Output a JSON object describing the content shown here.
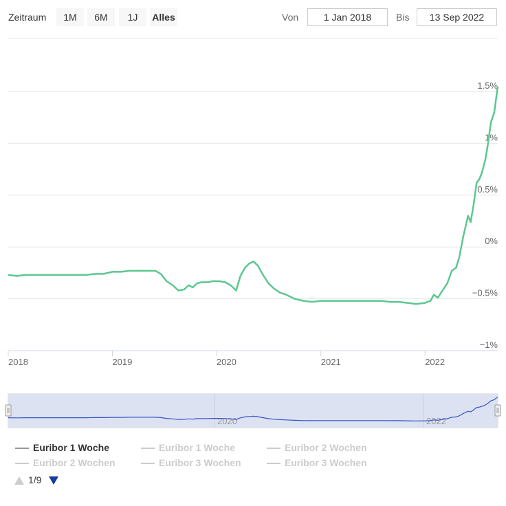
{
  "toolbar": {
    "zoom_label": "Zeitraum",
    "buttons": [
      "1M",
      "6M",
      "1J",
      "Alles"
    ],
    "active_button": "Alles",
    "from_label": "Von",
    "from_value": "1 Jan 2018",
    "to_label": "Bis",
    "to_value": "13 Sep 2022"
  },
  "legend": {
    "items": [
      "Euribor 1 Woche",
      "Euribor 1 Woche",
      "Euribor 2 Wochen",
      "Euribor 2 Wochen",
      "Euribor 3 Wochen",
      "Euribor 3 Wochen"
    ],
    "active_index": 0,
    "pager_text": "1/9"
  },
  "colors": {
    "series_line": "#5cc78f",
    "navigator_line": "#3356c2",
    "navigator_fill": "#dde2f2",
    "grid": "#e6e6e6",
    "inactive": "#cccccc",
    "arrow_active": "#1a3a9c"
  },
  "chart_data": {
    "type": "line",
    "title": "",
    "xlabel": "",
    "ylabel": "",
    "ylim": [
      -1,
      1.5
    ],
    "x_tick_labels": [
      "2018",
      "2019",
      "2020",
      "2021",
      "2022"
    ],
    "y_tick_labels": [
      "1.5%",
      "1%",
      "0.5%",
      "0%",
      "−0.5%",
      "−1%"
    ],
    "y_ticks": [
      1.5,
      1,
      0.5,
      0,
      -0.5,
      -1
    ],
    "navigator_labels": [
      "2020",
      "2022"
    ],
    "grid": true,
    "series": [
      {
        "name": "Euribor 1 Woche",
        "x": [
          "2018-01-01",
          "2018-02-01",
          "2018-03-01",
          "2018-04-01",
          "2018-05-01",
          "2018-06-01",
          "2018-07-01",
          "2018-08-01",
          "2018-09-01",
          "2018-10-01",
          "2018-11-01",
          "2018-12-01",
          "2019-01-01",
          "2019-02-01",
          "2019-03-01",
          "2019-04-01",
          "2019-05-01",
          "2019-06-01",
          "2019-06-20",
          "2019-07-10",
          "2019-08-01",
          "2019-08-20",
          "2019-09-10",
          "2019-09-25",
          "2019-10-10",
          "2019-10-25",
          "2019-11-10",
          "2019-12-01",
          "2019-12-20",
          "2020-01-10",
          "2020-02-01",
          "2020-02-20",
          "2020-03-10",
          "2020-03-25",
          "2020-04-10",
          "2020-04-25",
          "2020-05-10",
          "2020-05-25",
          "2020-06-10",
          "2020-07-01",
          "2020-07-20",
          "2020-08-10",
          "2020-09-01",
          "2020-10-01",
          "2020-11-01",
          "2020-12-01",
          "2021-01-01",
          "2021-02-01",
          "2021-03-01",
          "2021-04-01",
          "2021-05-01",
          "2021-06-01",
          "2021-07-01",
          "2021-08-01",
          "2021-09-01",
          "2021-10-01",
          "2021-11-01",
          "2021-12-01",
          "2022-01-01",
          "2022-01-20",
          "2022-02-01",
          "2022-02-15",
          "2022-03-01",
          "2022-03-20",
          "2022-04-05",
          "2022-04-20",
          "2022-05-01",
          "2022-05-15",
          "2022-06-01",
          "2022-06-10",
          "2022-06-20",
          "2022-07-01",
          "2022-07-10",
          "2022-07-20",
          "2022-08-01",
          "2022-08-10",
          "2022-08-20",
          "2022-09-01",
          "2022-09-13"
        ],
        "values": [
          -0.27,
          -0.28,
          -0.27,
          -0.27,
          -0.27,
          -0.27,
          -0.27,
          -0.27,
          -0.27,
          -0.27,
          -0.26,
          -0.26,
          -0.24,
          -0.24,
          -0.23,
          -0.23,
          -0.23,
          -0.23,
          -0.26,
          -0.33,
          -0.37,
          -0.42,
          -0.41,
          -0.37,
          -0.39,
          -0.35,
          -0.34,
          -0.34,
          -0.33,
          -0.33,
          -0.34,
          -0.37,
          -0.42,
          -0.28,
          -0.2,
          -0.16,
          -0.14,
          -0.18,
          -0.26,
          -0.35,
          -0.4,
          -0.44,
          -0.46,
          -0.5,
          -0.52,
          -0.53,
          -0.52,
          -0.52,
          -0.52,
          -0.52,
          -0.52,
          -0.52,
          -0.52,
          -0.52,
          -0.53,
          -0.53,
          -0.54,
          -0.55,
          -0.54,
          -0.52,
          -0.46,
          -0.49,
          -0.43,
          -0.35,
          -0.23,
          -0.2,
          -0.1,
          0.1,
          0.3,
          0.24,
          0.4,
          0.62,
          0.65,
          0.72,
          0.85,
          1.0,
          1.2,
          1.3,
          1.55
        ]
      }
    ]
  }
}
